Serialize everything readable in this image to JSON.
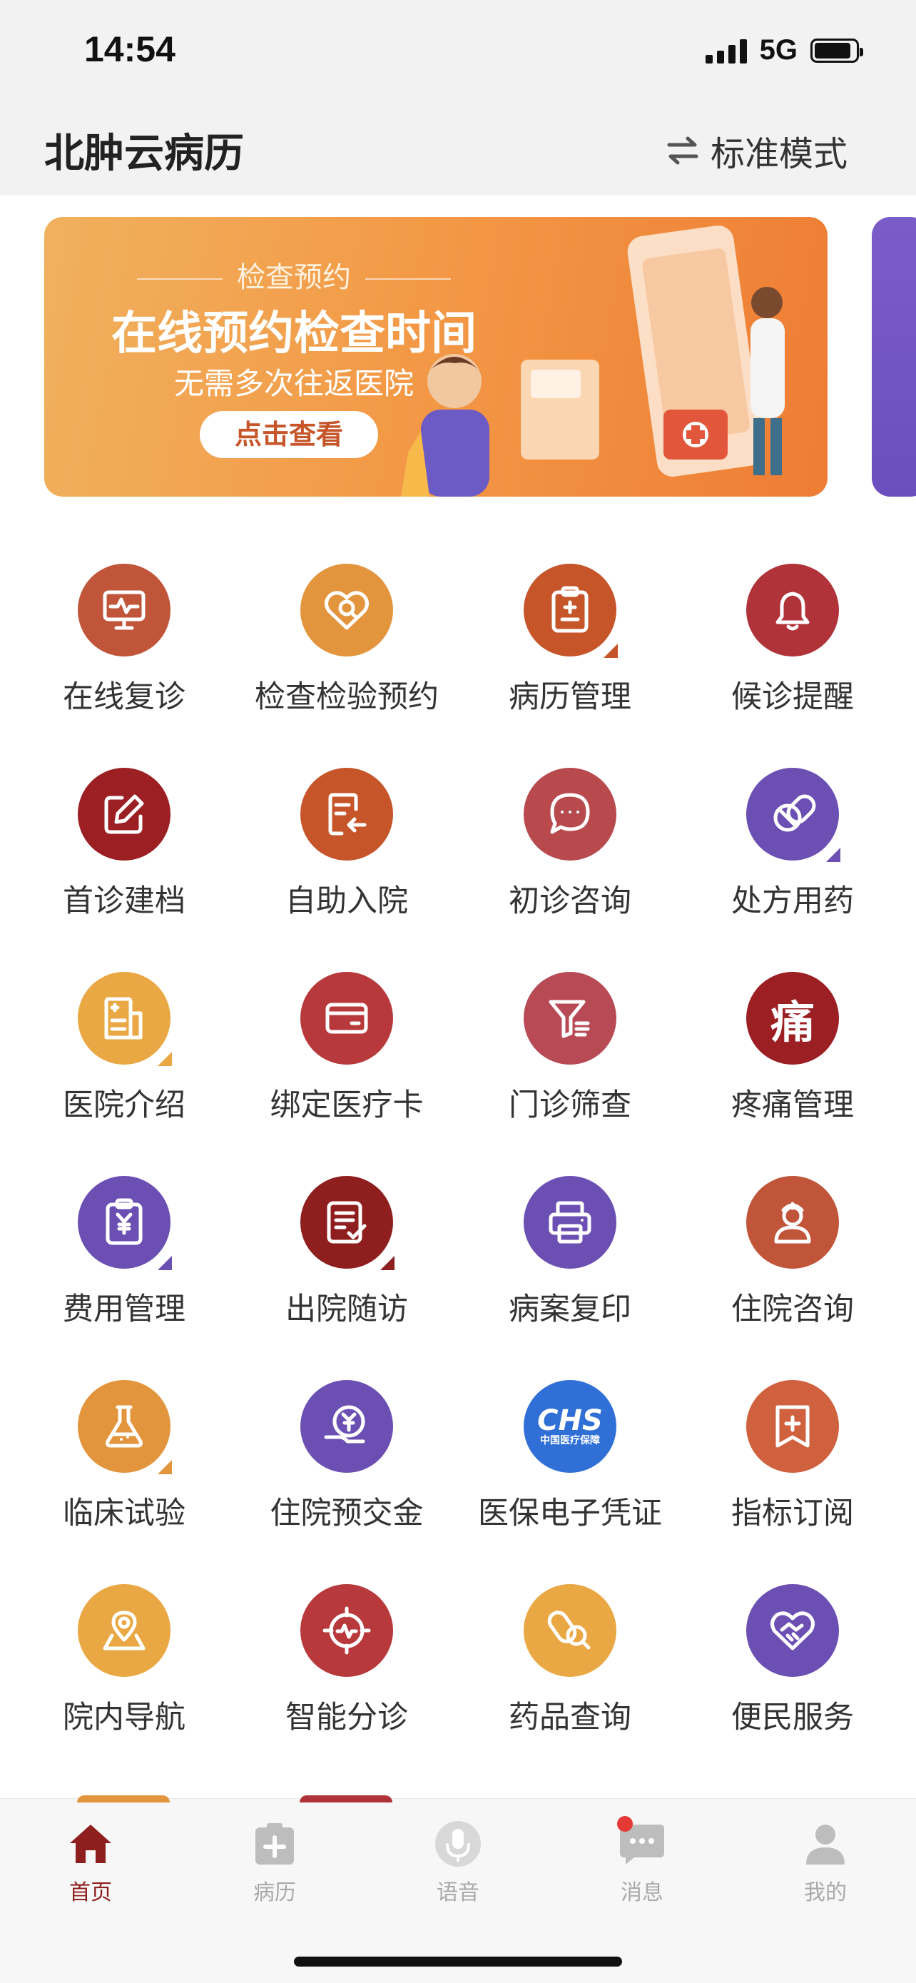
{
  "status_bar": {
    "time": "14:54",
    "network": "5G"
  },
  "header": {
    "title": "北肿云病历",
    "mode_label": "标准模式"
  },
  "banner": {
    "subtitle": "检查预约",
    "headline": "在线预约检查时间",
    "description": "无需多次往返医院",
    "cta": "点击查看"
  },
  "services": [
    {
      "label": "在线复诊",
      "icon": "monitor-pulse-icon",
      "color": "#c0553a",
      "corner": false
    },
    {
      "label": "检查检验预约",
      "icon": "heart-search-icon",
      "color": "#e3953d",
      "corner": false
    },
    {
      "label": "病历管理",
      "icon": "clipboard-plus-icon",
      "color": "#c6552a",
      "corner": true
    },
    {
      "label": "候诊提醒",
      "icon": "bell-icon",
      "color": "#b0333a",
      "corner": false
    },
    {
      "label": "首诊建档",
      "icon": "edit-icon",
      "color": "#9c1f24",
      "corner": false
    },
    {
      "label": "自助入院",
      "icon": "admission-icon",
      "color": "#c6552a",
      "corner": false
    },
    {
      "label": "初诊咨询",
      "icon": "chat-bubble-icon",
      "color": "#b84a4e",
      "corner": false
    },
    {
      "label": "处方用药",
      "icon": "pill-icon",
      "color": "#6b4fb3",
      "corner": true
    },
    {
      "label": "医院介绍",
      "icon": "hospital-building-icon",
      "color": "#e9a843",
      "corner": true
    },
    {
      "label": "绑定医疗卡",
      "icon": "card-icon",
      "color": "#b8393c",
      "corner": false
    },
    {
      "label": "门诊筛查",
      "icon": "filter-icon",
      "color": "#b84a55",
      "corner": false
    },
    {
      "label": "疼痛管理",
      "icon": "pain-char-icon",
      "color": "#9c1f24",
      "corner": false,
      "char": "痛"
    },
    {
      "label": "费用管理",
      "icon": "yuan-clipboard-icon",
      "color": "#6b4fb3",
      "corner": true
    },
    {
      "label": "出院随访",
      "icon": "document-check-icon",
      "color": "#8f1e1e",
      "corner": true
    },
    {
      "label": "病案复印",
      "icon": "printer-icon",
      "color": "#6b4fb3",
      "corner": false
    },
    {
      "label": "住院咨询",
      "icon": "nurse-icon",
      "color": "#c0553a",
      "corner": false
    },
    {
      "label": "临床试验",
      "icon": "flask-icon",
      "color": "#e3953d",
      "corner": true
    },
    {
      "label": "住院预交金",
      "icon": "yuan-hand-icon",
      "color": "#6b4fb3",
      "corner": false
    },
    {
      "label": "医保电子凭证",
      "icon": "chs-logo-icon",
      "color": "#2f6fd6",
      "corner": false,
      "logo_text": "CHS",
      "logo_sub": "中国医疗保障"
    },
    {
      "label": "指标订阅",
      "icon": "bookmark-plus-icon",
      "color": "#d0613e",
      "corner": false
    },
    {
      "label": "院内导航",
      "icon": "map-pin-icon",
      "color": "#e9a843",
      "corner": false
    },
    {
      "label": "智能分诊",
      "icon": "target-pulse-icon",
      "color": "#b8393c",
      "corner": false
    },
    {
      "label": "药品查询",
      "icon": "pill-search-icon",
      "color": "#e9a843",
      "corner": false
    },
    {
      "label": "便民服务",
      "icon": "heart-handshake-icon",
      "color": "#6b4fb3",
      "corner": false
    }
  ],
  "tabbar": [
    {
      "label": "首页",
      "icon": "home-icon",
      "active": true
    },
    {
      "label": "病历",
      "icon": "medical-record-icon",
      "active": false
    },
    {
      "label": "语音",
      "icon": "microphone-icon",
      "active": false
    },
    {
      "label": "消息",
      "icon": "message-icon",
      "active": false,
      "badge": true
    },
    {
      "label": "我的",
      "icon": "profile-icon",
      "active": false
    }
  ],
  "colors": {
    "active_tab": "#8f1e1e",
    "inactive_tab": "#a9a9a9",
    "badge": "#e53935"
  }
}
